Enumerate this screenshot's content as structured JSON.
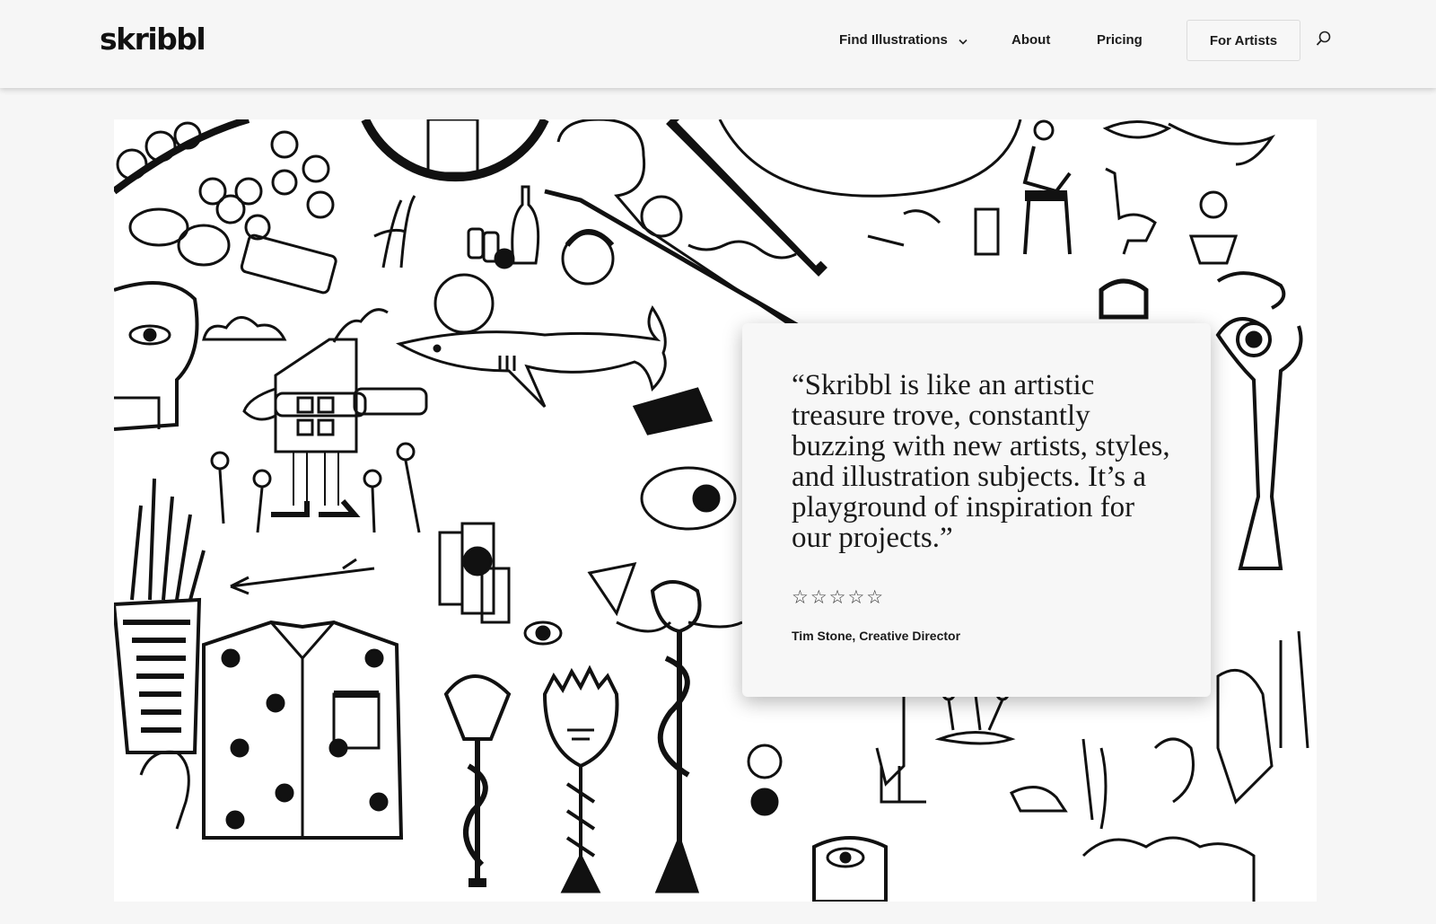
{
  "header": {
    "logo": "skribbl",
    "nav": {
      "find_illustrations": "Find Illustrations",
      "about": "About",
      "pricing": "Pricing",
      "for_artists": "For Artists"
    }
  },
  "testimonial": {
    "quote": "“Skribbl is like an artistic treasure trove, constantly buzzing with new artists, styles, and illustration subjects. It’s a playground of inspiration for our projects.”",
    "rating_stars": "☆☆☆☆☆",
    "rating": 5,
    "author": "Tim Stone, Creative Director"
  },
  "icons": {
    "dropdown": "chevron-down-icon",
    "search": "search-icon"
  },
  "colors": {
    "page_background": "#f6f6f6",
    "collage_background": "#ffffff",
    "ink": "#111111"
  }
}
